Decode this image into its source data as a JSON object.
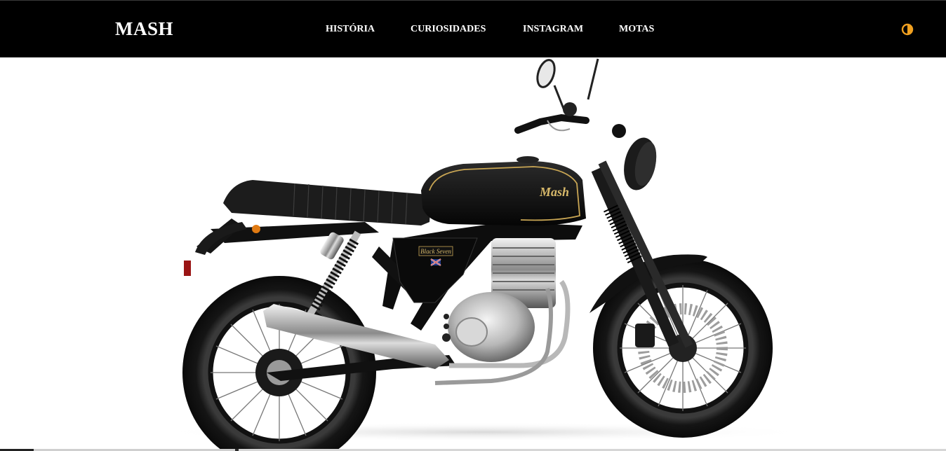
{
  "header": {
    "brand": "MASH",
    "nav": [
      {
        "label": "HISTÓRIA"
      },
      {
        "label": "CURIOSIDADES"
      },
      {
        "label": "INSTAGRAM"
      },
      {
        "label": "MOTAS"
      }
    ],
    "theme_toggle_icon": "contrast-icon",
    "accent_color": "#f0a020"
  },
  "hero": {
    "image": "motorcycle-photo",
    "tank_logo": "Mash",
    "side_badge": "Black Seven"
  }
}
